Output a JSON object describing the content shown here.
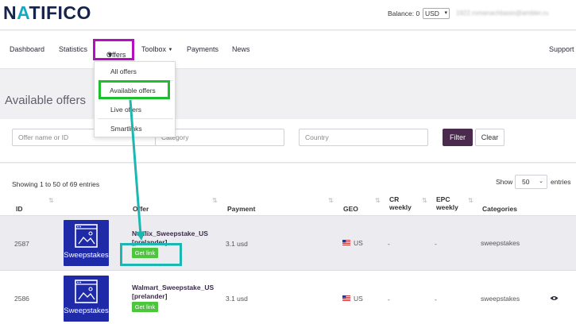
{
  "header": {
    "logo": {
      "prefix": "N",
      "accent": "A",
      "suffix": "TIFICO"
    },
    "balance_label": "Balance: 0",
    "currency": "USD",
    "email": "1922.romanachbasio@ambler.ru"
  },
  "nav": {
    "items": [
      {
        "label": "Dashboard"
      },
      {
        "label": "Statistics"
      },
      {
        "label": "Offers"
      },
      {
        "label": "Toolbox"
      },
      {
        "label": "Payments"
      },
      {
        "label": "News"
      },
      {
        "label": "Support"
      }
    ],
    "offers_dropdown": [
      {
        "label": "All offers"
      },
      {
        "label": "Available offers"
      },
      {
        "label": "Live offers"
      },
      {
        "label": "Smartlinks"
      }
    ]
  },
  "page": {
    "title": "Available offers"
  },
  "filters": {
    "offer_placeholder": "Offer name or ID",
    "category_placeholder": "Category",
    "country_placeholder": "Country",
    "filter_label": "Filter",
    "clear_label": "Clear"
  },
  "table": {
    "showing": "Showing 1 to 50 of 69 entries",
    "show_label": "Show",
    "page_size": "50",
    "entries_label": "entries",
    "columns": {
      "id": "ID",
      "offer": "Offer",
      "payment": "Payment",
      "geo": "GEO",
      "cr_weekly": [
        "CR",
        "weekly"
      ],
      "epc_weekly": [
        "EPC",
        "weekly"
      ],
      "categories": "Categories"
    },
    "rows": [
      {
        "id": "2587",
        "thumb_label": "Sweepstakes",
        "offer_name": "Netflix_Sweepstake_US",
        "offer_tag": "[prelander]",
        "get_link": "Get link",
        "payment": "3.1 usd",
        "geo": "US",
        "cr": "-",
        "epc": "-",
        "category": "sweepstakes"
      },
      {
        "id": "2586",
        "thumb_label": "Sweepstakes",
        "offer_name": "Walmart_Sweepstake_US",
        "offer_tag": "[prelander]",
        "get_link": "Get link",
        "payment": "3.1 usd",
        "geo": "US",
        "cr": "-",
        "epc": "-",
        "category": "sweepstakes"
      }
    ]
  },
  "colors": {
    "offers_highlight": "#b40fc0",
    "available_highlight": "#1fbe2f",
    "getlink_highlight": "#1cb7b0",
    "filter_button": "#4a2a4d",
    "get_link_button": "#4cc73b",
    "thumbnail": "#1e2aa8"
  },
  "icons": [
    "image-placeholder-icon",
    "us-flag-icon",
    "eye-icon",
    "sort-icon",
    "chevron-down-icon"
  ]
}
